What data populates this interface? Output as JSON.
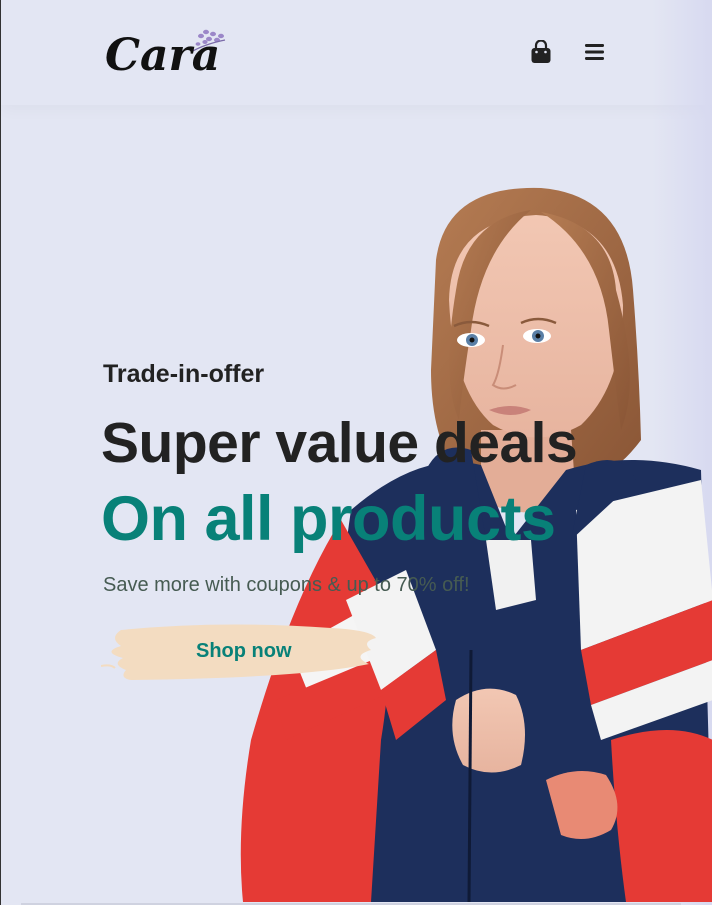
{
  "header": {
    "logo_text": "Cara",
    "cart_icon": "shopping-bag-icon",
    "menu_icon": "hamburger-menu-icon"
  },
  "hero": {
    "eyebrow": "Trade-in-offer",
    "headline": "Super value deals",
    "subheadline": "On all products",
    "description": "Save more with coupons & up to 70% off!",
    "button_label": "Shop now"
  },
  "colors": {
    "background": "#e3e6f3",
    "accent": "#088178",
    "heading": "#222222",
    "button_brush": "#f3dcc1"
  }
}
